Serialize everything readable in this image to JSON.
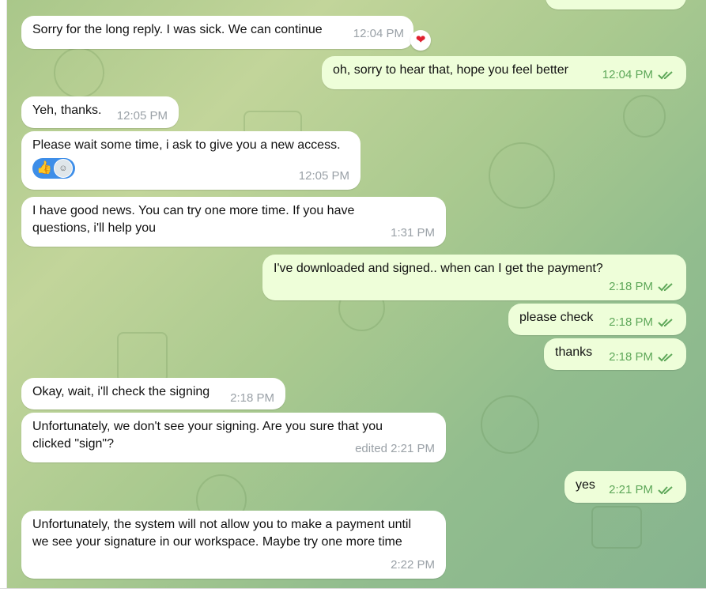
{
  "colors": {
    "incoming_bubble": "#ffffff",
    "outgoing_bubble": "#eefed9",
    "outgoing_meta": "#5fa85a",
    "incoming_meta": "#9aa1a7"
  },
  "messages": [
    {
      "id": "m1",
      "dir": "in",
      "text": "Sorry for the long reply. I was sick. We can continue",
      "time": "12:04 PM",
      "reaction": "heart-icon"
    },
    {
      "id": "m2",
      "dir": "out",
      "text": "oh, sorry to hear that, hope you feel better",
      "time": "12:04 PM",
      "read": true
    },
    {
      "id": "m3",
      "dir": "in",
      "text": "Yeh, thanks.",
      "time": "12:05 PM"
    },
    {
      "id": "m4",
      "dir": "in",
      "text": "Please wait some time, i ask to give you a new access.",
      "time": "12:05 PM",
      "reactions": [
        "thumbs-up-icon",
        "avatar"
      ]
    },
    {
      "id": "m5",
      "dir": "in",
      "text": "I have good news. You can try one more time. If you have questions, i'll help you",
      "time": "1:31 PM"
    },
    {
      "id": "m6",
      "dir": "out",
      "text": "I've downloaded and signed.. when can I get the payment?",
      "time": "2:18 PM",
      "read": true
    },
    {
      "id": "m7",
      "dir": "out",
      "text": "please check",
      "time": "2:18 PM",
      "read": true
    },
    {
      "id": "m8",
      "dir": "out",
      "text": "thanks",
      "time": "2:18 PM",
      "read": true
    },
    {
      "id": "m9",
      "dir": "in",
      "text": "Okay, wait, i'll check the signing",
      "time": "2:18 PM"
    },
    {
      "id": "m10",
      "dir": "in",
      "text": "Unfortunately, we don't see your signing. Are you sure that you clicked \"sign\"?",
      "time": "edited 2:21 PM"
    },
    {
      "id": "m11",
      "dir": "out",
      "text": "yes",
      "time": "2:21 PM",
      "read": true
    },
    {
      "id": "m12",
      "dir": "in",
      "text": "Unfortunately, the system will not allow you to make a payment until we see your signature in our workspace. Maybe try one more time",
      "time": "2:22 PM"
    }
  ]
}
